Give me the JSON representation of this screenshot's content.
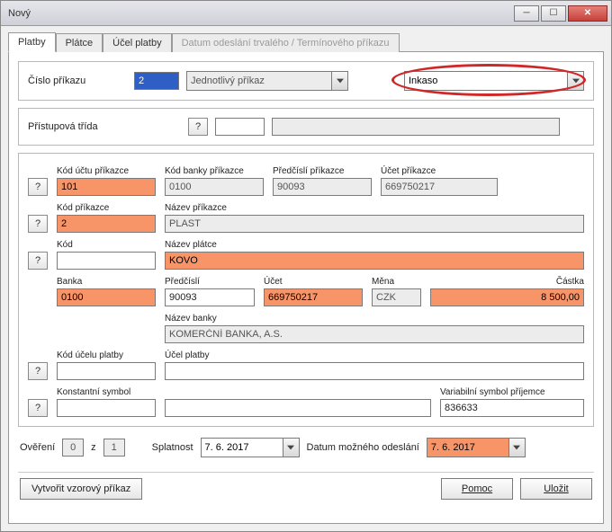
{
  "window": {
    "title": "Nový"
  },
  "tabs": {
    "platby": "Platby",
    "platce": "Plátce",
    "ucel": "Účel platby",
    "datum": "Datum odeslání trvalého / Termínového příkazu"
  },
  "head": {
    "cislo_prikazu_lbl": "Číslo příkazu",
    "cislo_prikazu_val": "2",
    "druh_sel": "Jednotlivý příkaz",
    "typ_sel": "Inkaso"
  },
  "pristup": {
    "label": "Přístupová třída",
    "q": "?",
    "val": "",
    "desc": ""
  },
  "block": {
    "kod_uctu_prikazce_lbl": "Kód účtu příkazce",
    "kod_uctu_prikazce_val": "101",
    "kod_banky_prikazce_lbl": "Kód banky příkazce",
    "kod_banky_prikazce_val": "0100",
    "predcisli_prikazce_lbl": "Předčíslí příkazce",
    "predcisli_prikazce_val": "90093",
    "ucet_prikazce_lbl": "Účet příkazce",
    "ucet_prikazce_val": "669750217",
    "kod_prikazce_lbl": "Kód příkazce",
    "kod_prikazce_val": "2",
    "nazev_prikazce_lbl": "Název příkazce",
    "nazev_prikazce_val": "PLAST",
    "kod_lbl": "Kód",
    "kod_val": "",
    "nazev_platce_lbl": "Název plátce",
    "nazev_platce_val": "KOVO",
    "banka_lbl": "Banka",
    "banka_val": "0100",
    "predcisli_lbl": "Předčíslí",
    "predcisli_val": "90093",
    "ucet_lbl": "Účet",
    "ucet_val": "669750217",
    "mena_lbl": "Měna",
    "mena_val": "CZK",
    "castka_lbl": "Částka",
    "castka_val": "8 500,00",
    "nazev_banky_lbl": "Název banky",
    "nazev_banky_val": "KOMERČNÍ BANKA, A.S.",
    "kod_ucelu_lbl": "Kód účelu platby",
    "kod_ucelu_val": "",
    "ucel_platby_lbl": "Účel platby",
    "ucel_platby_val": "",
    "konst_symbol_lbl": "Konstantní symbol",
    "konst_symbol_val": "",
    "mid_val": "",
    "var_symbol_lbl": "Variabilní symbol příjemce",
    "var_symbol_val": "836633",
    "q": "?"
  },
  "footer": {
    "overeni_lbl": "Ověření",
    "overeni_v1": "0",
    "overeni_z": "z",
    "overeni_v2": "1",
    "splatnost_lbl": "Splatnost",
    "splatnost_val": "7. 6. 2017",
    "datum_odeslani_lbl": "Datum možného odeslání",
    "datum_odeslani_val": "7. 6. 2017"
  },
  "buttons": {
    "vzor": "Vytvořit vzorový příkaz",
    "pomoc": "Pomoc",
    "ulozit": "Uložit"
  }
}
